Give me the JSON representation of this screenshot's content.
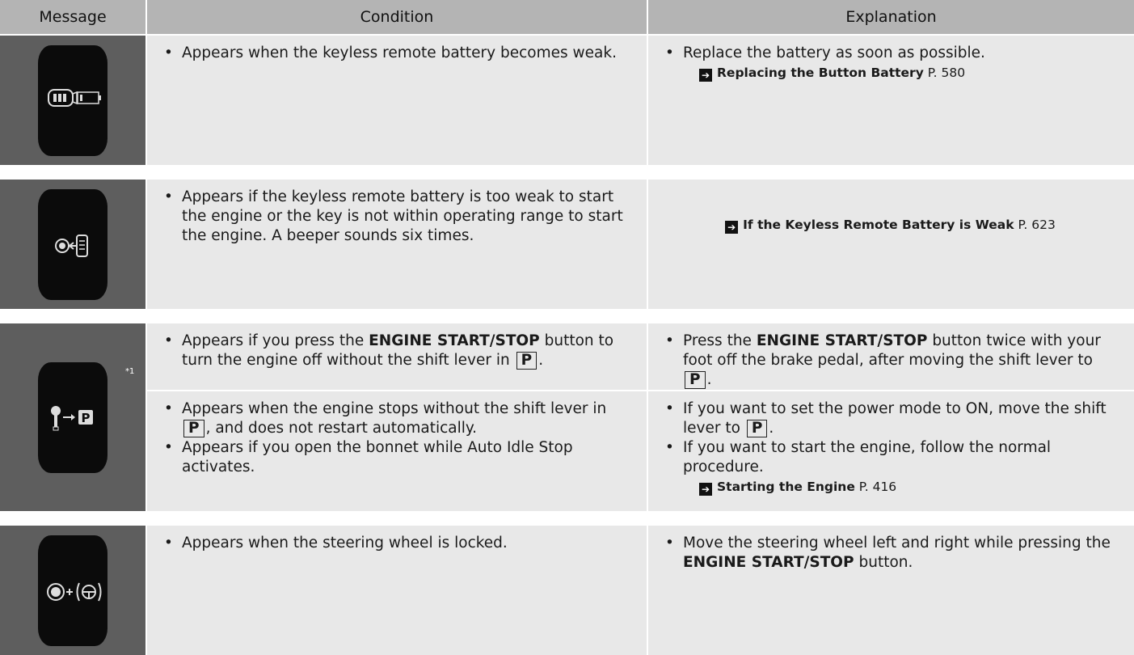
{
  "headers": {
    "message": "Message",
    "condition": "Condition",
    "explanation": "Explanation"
  },
  "rows": [
    {
      "icon": "keyless-remote-battery-low-icon",
      "condition": "Appears when the keyless remote battery becomes weak.",
      "explanation": "Replace the battery as soon as possible.",
      "ref_title": "Replacing the Button Battery",
      "ref_page": "P. 580"
    },
    {
      "icon": "key-to-start-button-icon",
      "condition": "Appears if the keyless remote battery is too weak to start the engine or the key is not within operating range to start the engine. A beeper sounds six times.",
      "ref_title": "If the Keyless Remote Battery is Weak",
      "ref_page": "P. 623"
    },
    {
      "icon": "shift-lever-to-park-icon",
      "footnote": "*1",
      "sub": [
        {
          "condition_pre": "Appears if you press the",
          "condition_bold": "ENGINE START/STOP",
          "condition_mid": "button to turn the engine off without the shift lever in",
          "park": "P",
          "condition_post": ".",
          "explanation_pre": "Press the",
          "explanation_bold": "ENGINE START/STOP",
          "explanation_post": "button twice with your foot off the brake pedal, after moving the shift lever to"
        },
        {
          "cond1_pre": "Appears when the engine stops without the shift lever in",
          "cond1_post": ", and does not restart automatically.",
          "cond2": "Appears if you open the bonnet while Auto Idle Stop activates.",
          "exp1_pre": "If you want to set the power mode to ON, move the shift lever to",
          "exp2": "If you want to start the engine, follow the normal procedure.",
          "ref_title": "Starting the Engine",
          "ref_page": "P. 416"
        }
      ]
    },
    {
      "icon": "start-button-plus-steering-wheel-icon",
      "condition": "Appears when the steering wheel is locked.",
      "explanation_pre": "Move the steering wheel left and right while pressing the",
      "explanation_bold": "ENGINE START/STOP",
      "explanation_post": "button."
    }
  ]
}
